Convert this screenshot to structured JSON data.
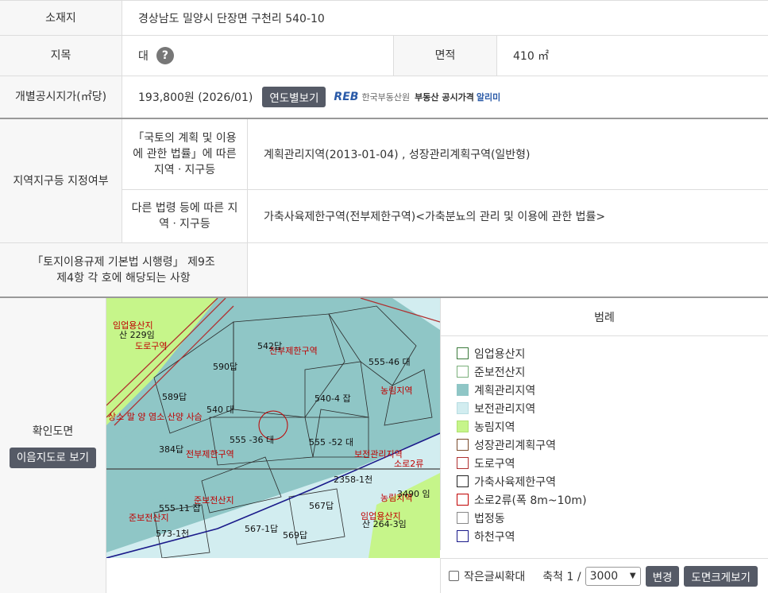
{
  "location": {
    "label": "소재지",
    "value": "경상남도 밀양시 단장면 구천리 540-10"
  },
  "jimok": {
    "label": "지목",
    "value": "대",
    "help": "?"
  },
  "area": {
    "label": "면적",
    "value": "410 ㎡"
  },
  "price": {
    "label": "개별공시지가(㎡당)",
    "value": "193,800원 (2026/01)",
    "button": "연도별보기",
    "reb_logo": "REB",
    "reb_org": "한국부동산원",
    "reb_service": "부동산 공시가격",
    "reb_app": "알리미"
  },
  "zoning": {
    "label": "지역지구등 지정여부",
    "national_label": "「국토의 계획 및 이용 에 관한 법률」에 따른 지역ㆍ지구등",
    "national_value": "계획관리지역(2013-01-04) , 성장관리계획구역(일반형)",
    "other_label": "다른 법령 등에 따른 지역ㆍ지구등",
    "other_value": "가축사육제한구역(전부제한구역)<가축분뇨의 관리 및 이용에 관한 법률>"
  },
  "regulation": {
    "label": "「토지이용규제 기본법 시행령」 제9조 제4항 각 호에 해당되는 사항",
    "value": ""
  },
  "map": {
    "label": "확인도면",
    "view_button": "이음지도로 보기",
    "labels": [
      "임업용산지",
      "산 229임",
      "도로구역",
      "590답",
      "542답",
      "전부제한구역",
      "589답",
      "540 대",
      "540-4 잡",
      "555 -36 대",
      "555 -52 대",
      "384답",
      "농림지역",
      "보전관리지역",
      "전부제한구역",
      "준보전산지",
      "2358-1천",
      "555-11 잡",
      "567답",
      "567-1답",
      "569답",
      "573-1천",
      "산 264-3임",
      "3490 임",
      "준보전산지",
      "임업용산지",
      "소로2류",
      "상소 말 양 염소 산양 사슴",
      "555-46 대",
      "농림지역"
    ]
  },
  "legend": {
    "title": "범례",
    "items": [
      {
        "label": "임업용산지",
        "color": "#ffffff",
        "border": "#3a7a3a"
      },
      {
        "label": "준보전산지",
        "color": "#ffffff",
        "border": "#7ab07a"
      },
      {
        "label": "계획관리지역",
        "color": "#8fc6c6",
        "border": "#8fc6c6"
      },
      {
        "label": "보전관리지역",
        "color": "#d2edf0",
        "border": "#b8dde2"
      },
      {
        "label": "농림지역",
        "color": "#c6f58a",
        "border": "#aee070"
      },
      {
        "label": "성장관리계획구역",
        "color": "#ffffff",
        "border": "#7a4a2a"
      },
      {
        "label": "도로구역",
        "color": "#ffffff",
        "border": "#b03030"
      },
      {
        "label": "가축사육제한구역",
        "color": "#ffffff",
        "border": "#222222"
      },
      {
        "label": "소로2류(폭 8m~10m)",
        "color": "#ffffff",
        "border": "#c00000"
      },
      {
        "label": "법정동",
        "color": "#ffffff",
        "border": "#888888"
      },
      {
        "label": "하천구역",
        "color": "#ffffff",
        "border": "#1a1a8a"
      }
    ]
  },
  "controls": {
    "small_font": "작은글씨확대",
    "scale_label": "축척 1 /",
    "scale_value": "3000",
    "change_button": "변경",
    "enlarge_button": "도면크게보기"
  }
}
